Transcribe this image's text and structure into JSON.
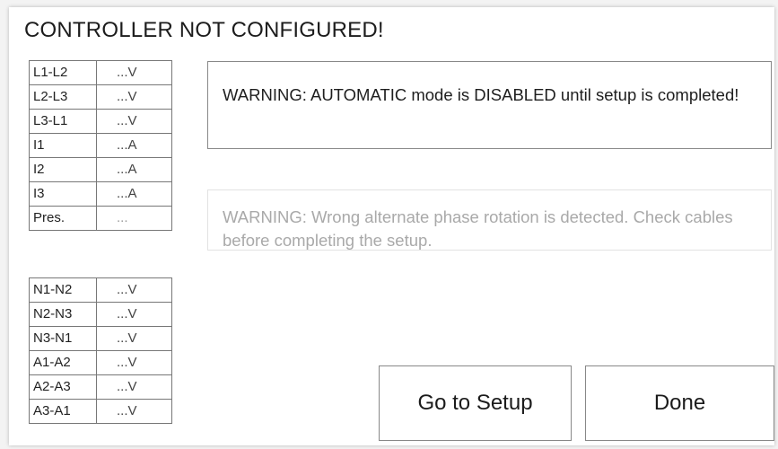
{
  "title": "CONTROLLER NOT CONFIGURED!",
  "main_readings": [
    {
      "label": "L1-L2",
      "value": "...V"
    },
    {
      "label": "L2-L3",
      "value": "...V"
    },
    {
      "label": "L3-L1",
      "value": "...V"
    },
    {
      "label": "I1",
      "value": "...A"
    },
    {
      "label": "I2",
      "value": "...A"
    },
    {
      "label": "I3",
      "value": "...A"
    },
    {
      "label": "Pres.",
      "value": "..."
    }
  ],
  "aux_readings": [
    {
      "label": "N1-N2",
      "value": "...V"
    },
    {
      "label": "N2-N3",
      "value": "...V"
    },
    {
      "label": "N3-N1",
      "value": "...V"
    },
    {
      "label": "A1-A2",
      "value": "...V"
    },
    {
      "label": "A2-A3",
      "value": "...V"
    },
    {
      "label": "A3-A1",
      "value": "...V"
    }
  ],
  "warnings": {
    "automatic_disabled": "WARNING: AUTOMATIC mode is DISABLED until setup is completed!",
    "phase_rotation": "WARNING: Wrong alternate phase rotation is detected. Check cables before completing the setup."
  },
  "buttons": {
    "setup": "Go to Setup",
    "done": "Done"
  }
}
